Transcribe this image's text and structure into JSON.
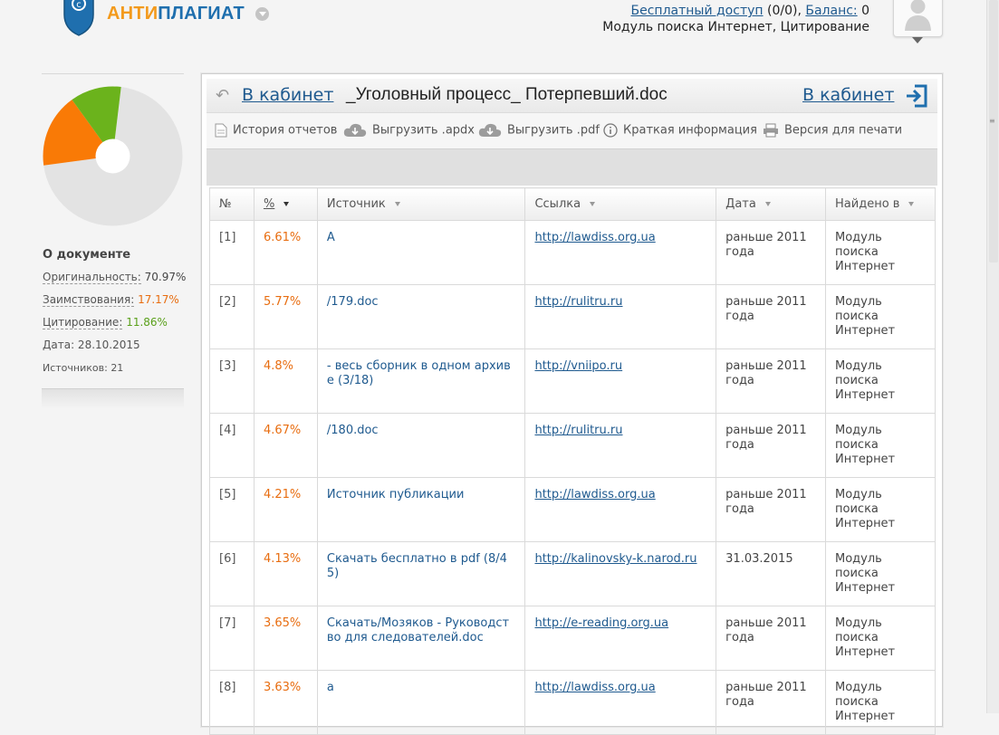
{
  "header": {
    "logo": {
      "part1": "АНТИ",
      "part2": "ПЛАГИАТ"
    },
    "account": {
      "free_access_link": "Бесплатный доступ",
      "free_access_count": " (0/0), ",
      "balance_link": "Баланс:",
      "balance_value": " 0",
      "modules": "Модуль поиска Интернет, Цитирование"
    }
  },
  "summary": {
    "title": "О документе",
    "originality_label": "Оригинальность:",
    "originality_value": "70.97%",
    "borrowing_label": "Заимствования:",
    "borrowing_value": "17.17%",
    "citation_label": "Цитирование:",
    "citation_value": "11.86%",
    "date_text": "Дата: 28.10.2015",
    "sources_text": "Источников: 21",
    "pie": [
      {
        "name": "originality",
        "value": 70.97,
        "color": "#e3e3e3"
      },
      {
        "name": "borrowing",
        "value": 17.17,
        "color": "#f97a06"
      },
      {
        "name": "citation",
        "value": 11.86,
        "color": "#6bb31c"
      }
    ]
  },
  "report": {
    "cabinet_left": "В кабинет",
    "doc_title": "_Уголовный процесс_ Потерпевший.doc",
    "cabinet_right": "В кабинет",
    "toolbar": {
      "history": "История отчетов",
      "export_apdx": "Выгрузить .apdx",
      "export_pdf": "Выгрузить .pdf",
      "brief_info": "Краткая информация",
      "print_version": "Версия для печати"
    },
    "columns": {
      "num": "№",
      "pct": "%",
      "source": "Источник",
      "link": "Ссылка",
      "date": "Дата",
      "found": "Найдено в"
    },
    "rows": [
      {
        "num": "[1]",
        "pct": "6.61%",
        "source": "А",
        "link": "http://lawdiss.org.ua",
        "date": "раньше 2011 года",
        "found": "Модуль поиска Интернет"
      },
      {
        "num": "[2]",
        "pct": "5.77%",
        "source": "/179.doc",
        "link": "http://rulitru.ru",
        "date": "раньше 2011 года",
        "found": "Модуль поиска Интернет"
      },
      {
        "num": "[3]",
        "pct": "4.8%",
        "source": "- весь сборник в одном архив е (3/18)",
        "link": "http://vniipo.ru",
        "date": "раньше 2011 года",
        "found": "Модуль поиска Интернет"
      },
      {
        "num": "[4]",
        "pct": "4.67%",
        "source": "/180.doc",
        "link": "http://rulitru.ru",
        "date": "раньше 2011 года",
        "found": "Модуль поиска Интернет"
      },
      {
        "num": "[5]",
        "pct": "4.21%",
        "source": "Источник публикации",
        "link": "http://lawdiss.org.ua",
        "date": "раньше 2011 года",
        "found": "Модуль поиска Интернет"
      },
      {
        "num": "[6]",
        "pct": "4.13%",
        "source": "Скачать бесплатно в pdf (8/4 5)",
        "link": "http://kalinovsky-k.narod.ru",
        "date": "31.03.2015",
        "found": "Модуль поиска Интернет"
      },
      {
        "num": "[7]",
        "pct": "3.65%",
        "source": "Скачать/Мозяков - Руководст во для следователей.doc",
        "link": "http://e-reading.org.ua",
        "date": "раньше 2011 года",
        "found": "Модуль поиска Интернет"
      },
      {
        "num": "[8]",
        "pct": "3.63%",
        "source": "а",
        "link": "http://lawdiss.org.ua",
        "date": "раньше 2011 года",
        "found": "Модуль поиска Интернет"
      }
    ]
  }
}
